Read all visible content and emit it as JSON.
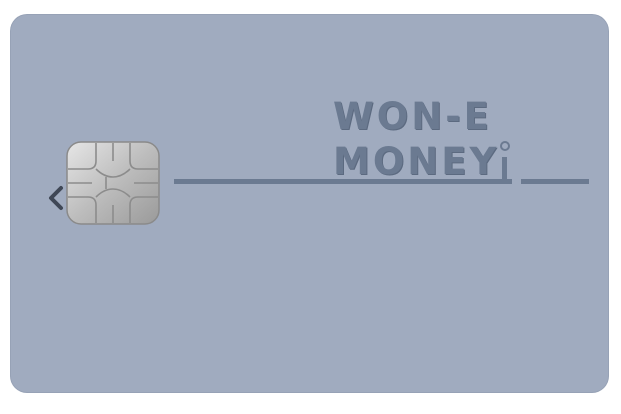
{
  "card": {
    "brand_line1": "WON-E",
    "brand_line2": "MONEY",
    "colors": {
      "card_background": "#a0abbf",
      "brand_text": "#6b7a91"
    },
    "icons": [
      "chevron-left-icon",
      "emv-chip-icon"
    ]
  }
}
